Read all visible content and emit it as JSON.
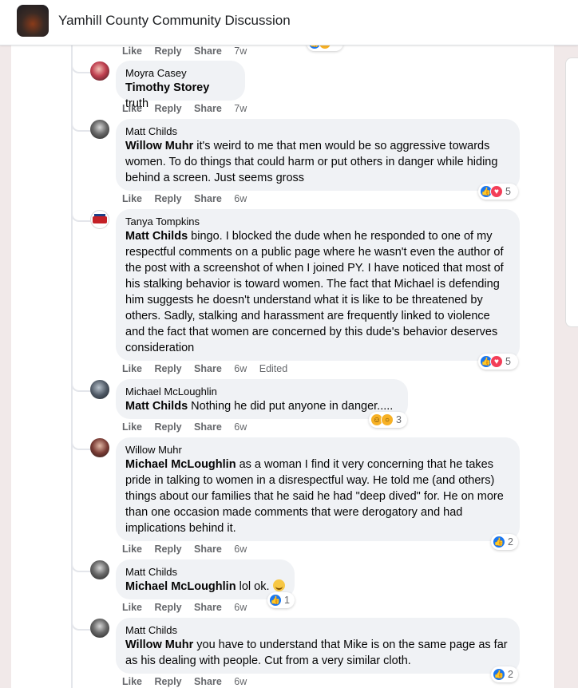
{
  "header": {
    "group_name": "Yamhill County Community Discussion"
  },
  "actions_labels": {
    "like": "Like",
    "reply": "Reply",
    "share": "Share"
  },
  "top_row": {
    "time": "7w"
  },
  "comments": [
    {
      "author": "Moyra Casey",
      "mention": "Timothy Storey",
      "text": " truth",
      "time": "7w"
    },
    {
      "author": "Matt Childs",
      "mention": "Willow Muhr",
      "text": " it's weird to me that men would be so aggressive towards women. To do things that could harm or put others in danger while hiding behind a screen. Just seems gross",
      "time": "6w",
      "reactions": {
        "count": "5",
        "icons": [
          "like-icon",
          "love-icon"
        ]
      }
    },
    {
      "author": "Tanya Tompkins",
      "mention": "Matt Childs",
      "text": " bingo. I blocked the dude when he responded to one of my respectful comments on a public page where he wasn't even the author of the post with a screenshot of when I joined PY. I have noticed that most of his stalking behavior is toward women. The fact that Michael is defending him suggests he doesn't understand what it is like to be threatened by others. Sadly, stalking and harassment are frequently linked to violence and the fact that women are concerned by this dude's behavior deserves consideration",
      "time": "6w",
      "edited": "Edited",
      "reactions": {
        "count": "5",
        "icons": [
          "like-icon",
          "love-icon"
        ]
      }
    },
    {
      "author": "Michael McLoughlin",
      "mention": "Matt Childs",
      "text": " Nothing he did put anyone in danger.....",
      "time": "6w",
      "reactions": {
        "count": "3",
        "icons": [
          "haha-icon",
          "wow-icon"
        ]
      }
    },
    {
      "author": "Willow Muhr",
      "mention": "Michael McLoughlin",
      "text": " as a woman I find it very concerning that he takes pride in talking to women in a disrespectful way. He told me (and others) things about our families that he said he had \"deep dived\" for. He on more than one occasion made comments that were derogatory and had implications behind it.",
      "time": "6w",
      "reactions": {
        "count": "2",
        "icons": [
          "like-icon"
        ]
      }
    },
    {
      "author": "Matt Childs",
      "mention": "Michael McLoughlin",
      "text": " lol ok.",
      "time": "6w",
      "reactions": {
        "count": "1",
        "icons": [
          "like-icon"
        ]
      }
    },
    {
      "author": "Matt Childs",
      "mention": "Willow Muhr",
      "text": " you have to understand that Mike is on the same page as far as his dealing with people. Cut from a very similar cloth.",
      "time": "6w",
      "reactions": {
        "count": "2",
        "icons": [
          "like-icon"
        ]
      }
    }
  ]
}
